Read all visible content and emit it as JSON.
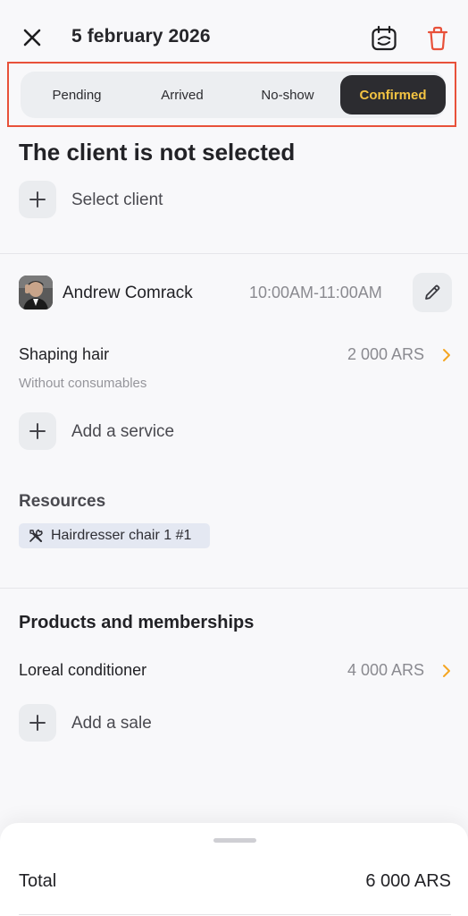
{
  "header": {
    "title": "5 february 2026",
    "close_icon": "close-icon",
    "calendar_icon": "calendar-repeat-icon",
    "trash_icon": "trash-icon",
    "trash_color": "#e8513a"
  },
  "status_tabs": {
    "items": [
      {
        "label": "Pending",
        "active": false
      },
      {
        "label": "Arrived",
        "active": false
      },
      {
        "label": "No-show",
        "active": false
      },
      {
        "label": "Confirmed",
        "active": true
      }
    ],
    "active_bg": "#2c2c30",
    "active_text_color": "#f4c442"
  },
  "client": {
    "title": "The client is not selected",
    "select_label": "Select client"
  },
  "staff": {
    "name": "Andrew Comrack",
    "time": "10:00AM-11:00AM"
  },
  "services": {
    "items": [
      {
        "name": "Shaping hair",
        "price": "2 000 ARS",
        "note": "Without consumables"
      }
    ],
    "add_label": "Add a service"
  },
  "resources": {
    "title": "Resources",
    "items": [
      {
        "label": "Hairdresser chair 1 #1",
        "icon": "tools-icon"
      }
    ]
  },
  "products": {
    "title": "Products and memberships",
    "items": [
      {
        "name": "Loreal conditioner",
        "price": "4 000 ARS"
      }
    ],
    "add_label": "Add a sale"
  },
  "summary": {
    "total_label": "Total",
    "total_value": "6 000 ARS"
  },
  "colors": {
    "accent": "#f4a623",
    "highlight_border": "#e8513a"
  }
}
